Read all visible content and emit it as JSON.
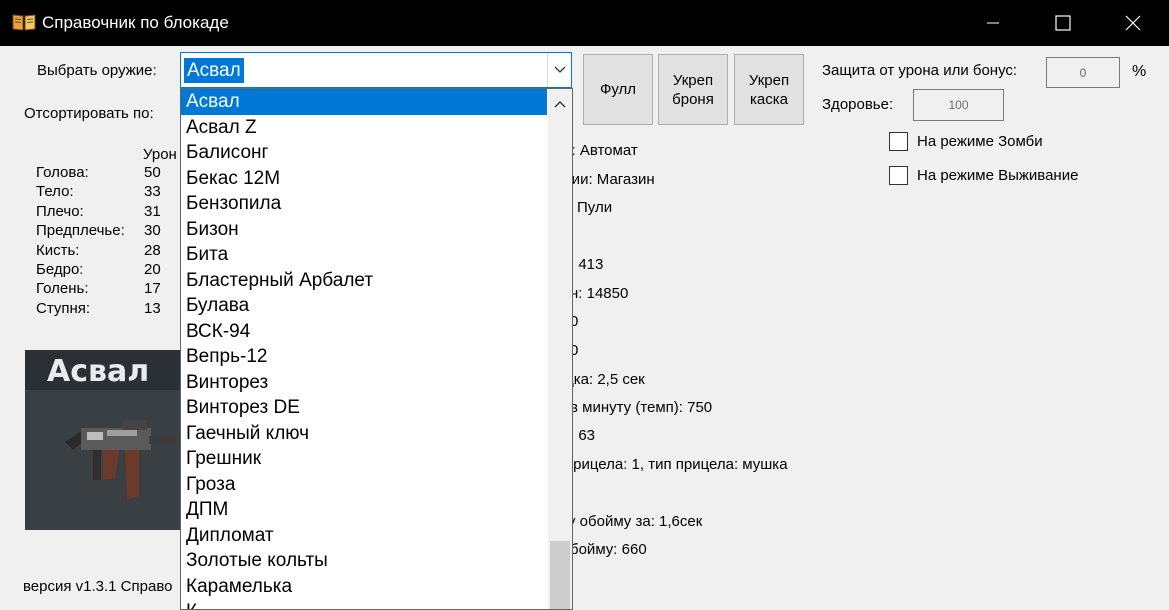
{
  "window": {
    "title": "Справочник по блокаде",
    "icon": "book-icon"
  },
  "labels": {
    "choose_weapon": "Выбрать оружие:",
    "sort_by": "Отсортировать по:",
    "protection": "Защита от урона или бонус:",
    "percent": "%",
    "health": "Здоровье:",
    "damage_header": "Урон",
    "version": "версия v1.3.1 Справо"
  },
  "combo": {
    "selected": "Асвал"
  },
  "buttons": {
    "full": "Фулл",
    "armor_line1": "Укреп",
    "armor_line2": "броня",
    "helmet_line1": "Укреп",
    "helmet_line2": "каска"
  },
  "inputs": {
    "protection_value": "0",
    "health_value": "100"
  },
  "checkboxes": {
    "zombie": "На режиме Зомби",
    "survival": "На режиме Выживание"
  },
  "damage_stats": [
    {
      "part": "Голова:",
      "value": "50"
    },
    {
      "part": "Тело:",
      "value": "33"
    },
    {
      "part": "Плечо:",
      "value": "31"
    },
    {
      "part": "Предплечье:",
      "value": "30"
    },
    {
      "part": "Кисть:",
      "value": "28"
    },
    {
      "part": "Бедро:",
      "value": "20"
    },
    {
      "part": "Голень:",
      "value": "17"
    },
    {
      "part": "Ступня:",
      "value": "13"
    }
  ],
  "weapon_image_caption": "Асвал",
  "info_lines": [
    "ия: Автомат",
    "ерии: Магазин",
    "Пули",
    ": 413",
    "н: 14850",
    "0",
    "0",
    "дка: 2,5 сек",
    "в минуту (темп): 750",
    ": 63",
    "прицела: 1, тип прицела: мушка",
    "у обойму за: 1,6сек",
    "бойму: 660"
  ],
  "dropdown_items": [
    "Асвал",
    "Асвал Z",
    "Балисонг",
    "Бекас 12М",
    "Бензопила",
    "Бизон",
    "Бита",
    "Бластерный Арбалет",
    "Булава",
    "ВСК-94",
    "Вепрь-12",
    "Винторез",
    "Винторез DE",
    "Гаечный ключ",
    "Грешник",
    "Гроза",
    "ДПМ",
    "Дипломат",
    "Золотые кольты",
    "Карамелька",
    "К"
  ],
  "colors": {
    "accent": "#0078d7",
    "titlebar": "#000000",
    "window_bg": "#f0f0f0"
  }
}
